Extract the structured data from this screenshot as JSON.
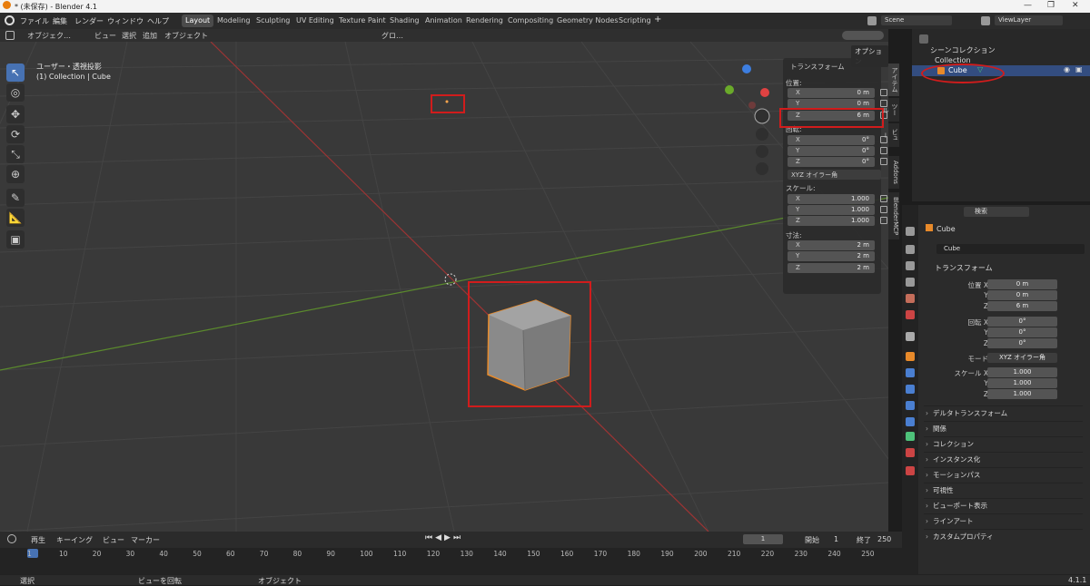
{
  "window": {
    "title": "* (未保存) - Blender 4.1"
  },
  "menus": [
    "ファイル",
    "編集",
    "レンダー",
    "ウィンドウ",
    "ヘルプ"
  ],
  "workspaces": [
    "Layout",
    "Modeling",
    "Sculpting",
    "UV Editing",
    "Texture Paint",
    "Shading",
    "Animation",
    "Rendering",
    "Compositing",
    "Geometry Nodes",
    "Scripting"
  ],
  "active_workspace": "Layout",
  "scene": {
    "name": "Scene",
    "view_layer": "ViewLayer"
  },
  "viewport_header": {
    "mode": "オブジェク…",
    "menus": [
      "ビュー",
      "選択",
      "追加",
      "オブジェクト"
    ],
    "transform_orientation": "グロ…",
    "options": "オプション"
  },
  "viewport": {
    "view_name": "ユーザー・透視投影",
    "context": "(1) Collection | Cube"
  },
  "nbar": {
    "title": "トランスフォーム",
    "location_label": "位置:",
    "location": [
      {
        "axis": "X",
        "value": "0 m"
      },
      {
        "axis": "Y",
        "value": "0 m"
      },
      {
        "axis": "Z",
        "value": "6 m"
      }
    ],
    "rotation_label": "回転:",
    "rotation": [
      {
        "axis": "X",
        "value": "0°"
      },
      {
        "axis": "Y",
        "value": "0°"
      },
      {
        "axis": "Z",
        "value": "0°"
      }
    ],
    "rotation_mode": "XYZ オイラー角",
    "scale_label": "スケール:",
    "scale": [
      {
        "axis": "X",
        "value": "1.000"
      },
      {
        "axis": "Y",
        "value": "1.000"
      },
      {
        "axis": "Z",
        "value": "1.000"
      }
    ],
    "dimensions_label": "寸法:",
    "dimensions": [
      {
        "axis": "X",
        "value": "2 m"
      },
      {
        "axis": "Y",
        "value": "2 m"
      },
      {
        "axis": "Z",
        "value": "2 m"
      }
    ]
  },
  "side_tabs": [
    "アイテム",
    "ツール",
    "ビュー",
    "Addons",
    "BlenderMCP"
  ],
  "outliner": {
    "root": "シーンコレクション",
    "collection": "Collection",
    "object": "Cube"
  },
  "properties": {
    "search_placeholder": "検索",
    "object_name": "Cube",
    "data_name": "Cube",
    "transform_title": "トランスフォーム",
    "location_labels": [
      "位置 X",
      "Y",
      "Z"
    ],
    "location_values": [
      "0 m",
      "0 m",
      "6 m"
    ],
    "rotation_labels": [
      "回転 X",
      "Y",
      "Z"
    ],
    "rotation_values": [
      "0°",
      "0°",
      "0°"
    ],
    "mode_label": "モード",
    "mode_value": "XYZ オイラー角",
    "scale_labels": [
      "スケール X",
      "Y",
      "Z"
    ],
    "scale_values": [
      "1.000",
      "1.000",
      "1.000"
    ],
    "panels": [
      "デルタトランスフォーム",
      "関係",
      "コレクション",
      "インスタンス化",
      "モーションパス",
      "可視性",
      "ビューポート表示",
      "ラインアート",
      "カスタムプロパティ"
    ]
  },
  "timeline": {
    "menus": [
      "再生",
      "キーイング",
      "ビュー",
      "マーカー"
    ],
    "current_frame": "1",
    "start_label": "開始",
    "start": "1",
    "end_label": "終了",
    "end": "250",
    "ticks": [
      "1",
      "10",
      "20",
      "30",
      "40",
      "50",
      "60",
      "70",
      "80",
      "90",
      "100",
      "110",
      "120",
      "130",
      "140",
      "150",
      "160",
      "170",
      "180",
      "190",
      "200",
      "210",
      "220",
      "230",
      "240",
      "250"
    ]
  },
  "status": {
    "select": "選択",
    "rotate": "ビューを回転",
    "object": "オブジェクト",
    "version": "4.1.1"
  }
}
